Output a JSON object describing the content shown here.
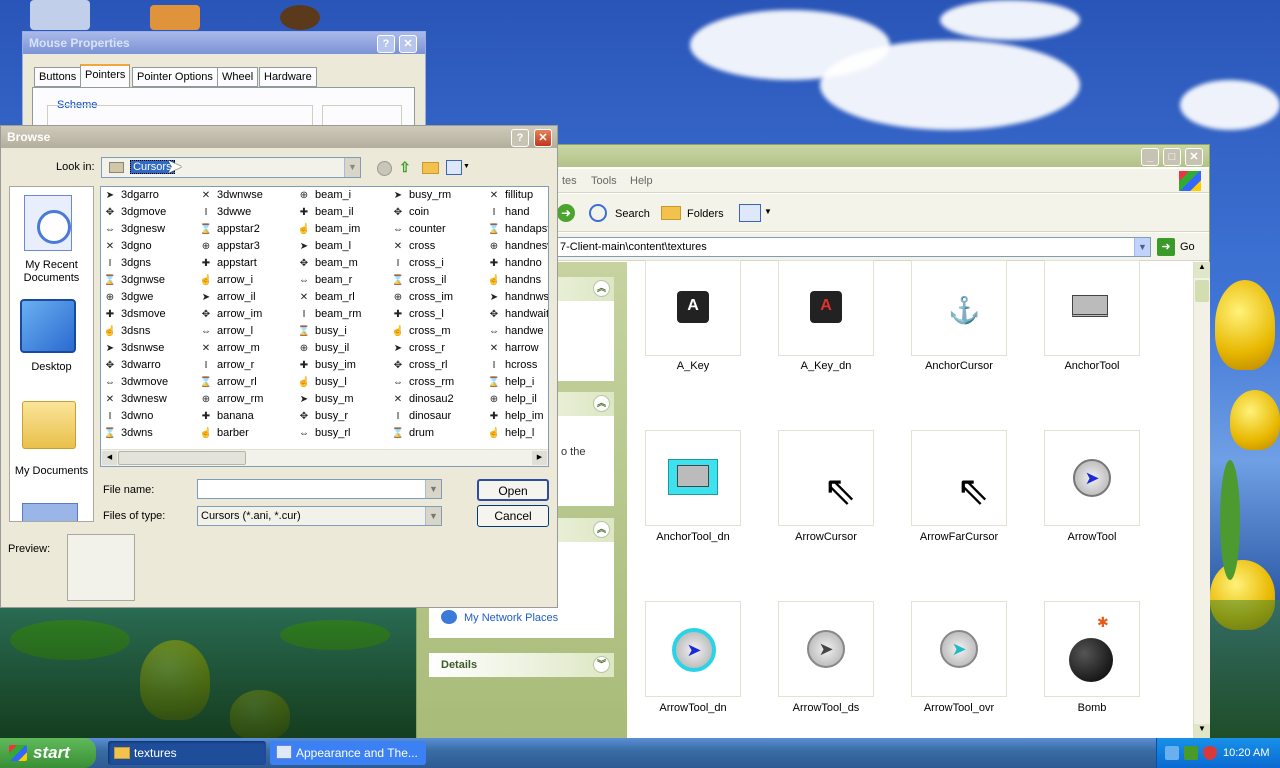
{
  "mouse_props": {
    "title": "Mouse Properties",
    "tabs": [
      "Buttons",
      "Pointers",
      "Pointer Options",
      "Wheel",
      "Hardware"
    ],
    "scheme_label": "Scheme"
  },
  "browse": {
    "title": "Browse",
    "look_in_label": "Look in:",
    "look_in_value": "Cursors",
    "places": [
      "My Recent Documents",
      "Desktop",
      "My Documents"
    ],
    "files": [
      [
        "3dgarro",
        "3dgmove",
        "3dgnesw",
        "3dgno",
        "3dgns",
        "3dgnwse",
        "3dgwe",
        "3dsmove",
        "3dsns",
        "3dsnwse",
        "3dwarro",
        "3dwmove",
        "3dwnesw",
        "3dwno",
        "3dwns"
      ],
      [
        "3dwnwse",
        "3dwwe",
        "appstar2",
        "appstar3",
        "appstart",
        "arrow_i",
        "arrow_il",
        "arrow_im",
        "arrow_l",
        "arrow_m",
        "arrow_r",
        "arrow_rl",
        "arrow_rm",
        "banana",
        "barber"
      ],
      [
        "beam_i",
        "beam_il",
        "beam_im",
        "beam_l",
        "beam_m",
        "beam_r",
        "beam_rl",
        "beam_rm",
        "busy_i",
        "busy_il",
        "busy_im",
        "busy_l",
        "busy_m",
        "busy_r",
        "busy_rl"
      ],
      [
        "busy_rm",
        "coin",
        "counter",
        "cross",
        "cross_i",
        "cross_il",
        "cross_im",
        "cross_l",
        "cross_m",
        "cross_r",
        "cross_rl",
        "cross_rm",
        "dinosau2",
        "dinosaur",
        "drum"
      ],
      [
        "fillitup",
        "hand",
        "handapst",
        "handnesw",
        "handno",
        "handns",
        "handnwse",
        "handwait",
        "handwe",
        "harrow",
        "hcross",
        "help_i",
        "help_il",
        "help_im",
        "help_l"
      ]
    ],
    "file_name_label": "File name:",
    "file_name_value": "",
    "files_of_type_label": "Files of type:",
    "files_of_type_value": "Cursors (*.ani, *.cur)",
    "open_label": "Open",
    "cancel_label": "Cancel",
    "preview_label": "Preview:"
  },
  "explorer": {
    "menu": [
      "tes",
      "Tools",
      "Help"
    ],
    "search_label": "Search",
    "folders_label": "Folders",
    "address": "7-Client-main\\content\\textures",
    "go_label": "Go",
    "partial_text": "o the",
    "network_places": "My Network Places",
    "details_label": "Details",
    "tiles": [
      {
        "name": "A_Key",
        "kind": "key",
        "color": "#ffffff"
      },
      {
        "name": "A_Key_dn",
        "kind": "key",
        "color": "#e03030"
      },
      {
        "name": "AnchorCursor",
        "kind": "anchor"
      },
      {
        "name": "AnchorTool",
        "kind": "tool"
      },
      {
        "name": "AnchorTool_dn",
        "kind": "tooldn"
      },
      {
        "name": "ArrowCursor",
        "kind": "arrow"
      },
      {
        "name": "ArrowFarCursor",
        "kind": "arrow"
      },
      {
        "name": "ArrowTool",
        "kind": "circle",
        "color": "#1a2ad8"
      },
      {
        "name": "ArrowTool_dn",
        "kind": "circlering",
        "color": "#1a2ad8"
      },
      {
        "name": "ArrowTool_ds",
        "kind": "circle",
        "color": "#444444"
      },
      {
        "name": "ArrowTool_ovr",
        "kind": "circle",
        "color": "#22b8c8"
      },
      {
        "name": "Bomb",
        "kind": "bomb"
      }
    ]
  },
  "taskbar": {
    "start_label": "start",
    "tasks": [
      "textures",
      "Appearance and The..."
    ],
    "clock": "10:20 AM"
  },
  "colors": {
    "xp_blue": "#0831d9",
    "explorer_green": "#c5d29c",
    "taskbar": "#3a6ea5"
  }
}
